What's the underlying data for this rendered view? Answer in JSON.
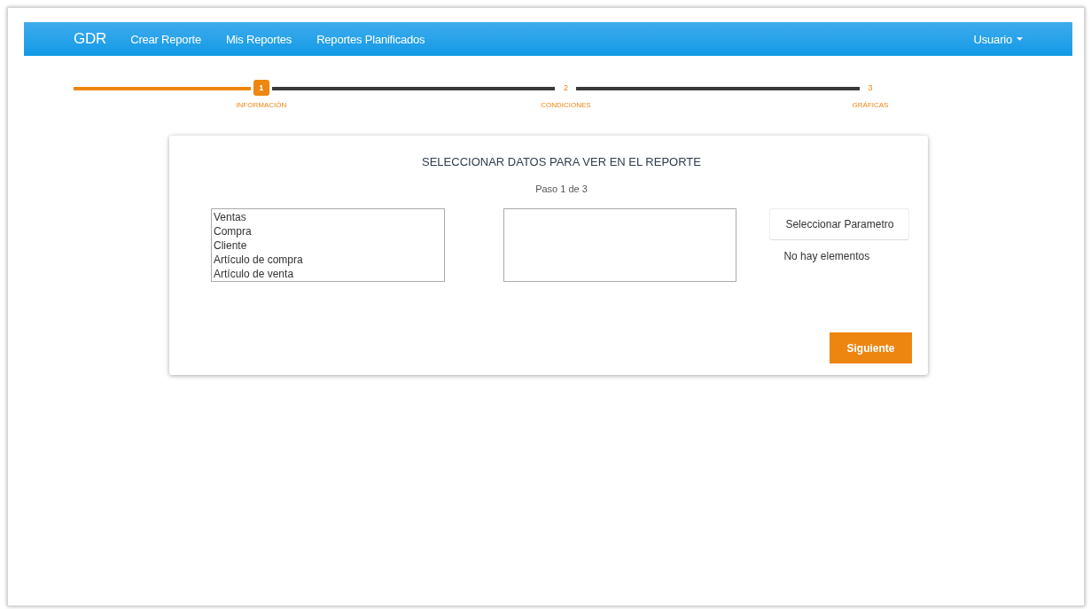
{
  "navbar": {
    "brand": "GDR",
    "links": [
      {
        "label": "Crear Reporte"
      },
      {
        "label": "Mis Reportes"
      },
      {
        "label": "Reportes Planificados"
      }
    ],
    "user_menu": "Usuario"
  },
  "stepper": {
    "steps": [
      {
        "number": "1",
        "label": "INFORMACIÓN",
        "selected": true
      },
      {
        "number": "2",
        "label": "CONDICIONES",
        "selected": false
      },
      {
        "number": "3",
        "label": "GRÁFICAS",
        "selected": false
      }
    ]
  },
  "card": {
    "title": "SELECCIONAR DATOS PARA VER EN EL REPORTE",
    "subtitle": "Paso 1 de 3",
    "lists": [
      {
        "kind": "listbox",
        "items": [
          {
            "label": "Ventas",
            "selected": false
          },
          {
            "label": "Compra",
            "selected": false
          },
          {
            "label": "Cliente",
            "selected": false
          },
          {
            "label": "Artículo de compra",
            "selected": false
          },
          {
            "label": "Artículo de venta",
            "selected": false
          }
        ]
      },
      {
        "kind": "listbox"
      }
    ],
    "parameter_button": "Seleccionar Parametro",
    "empty_message": "No hay elementos",
    "next_button": "Siguiente"
  }
}
